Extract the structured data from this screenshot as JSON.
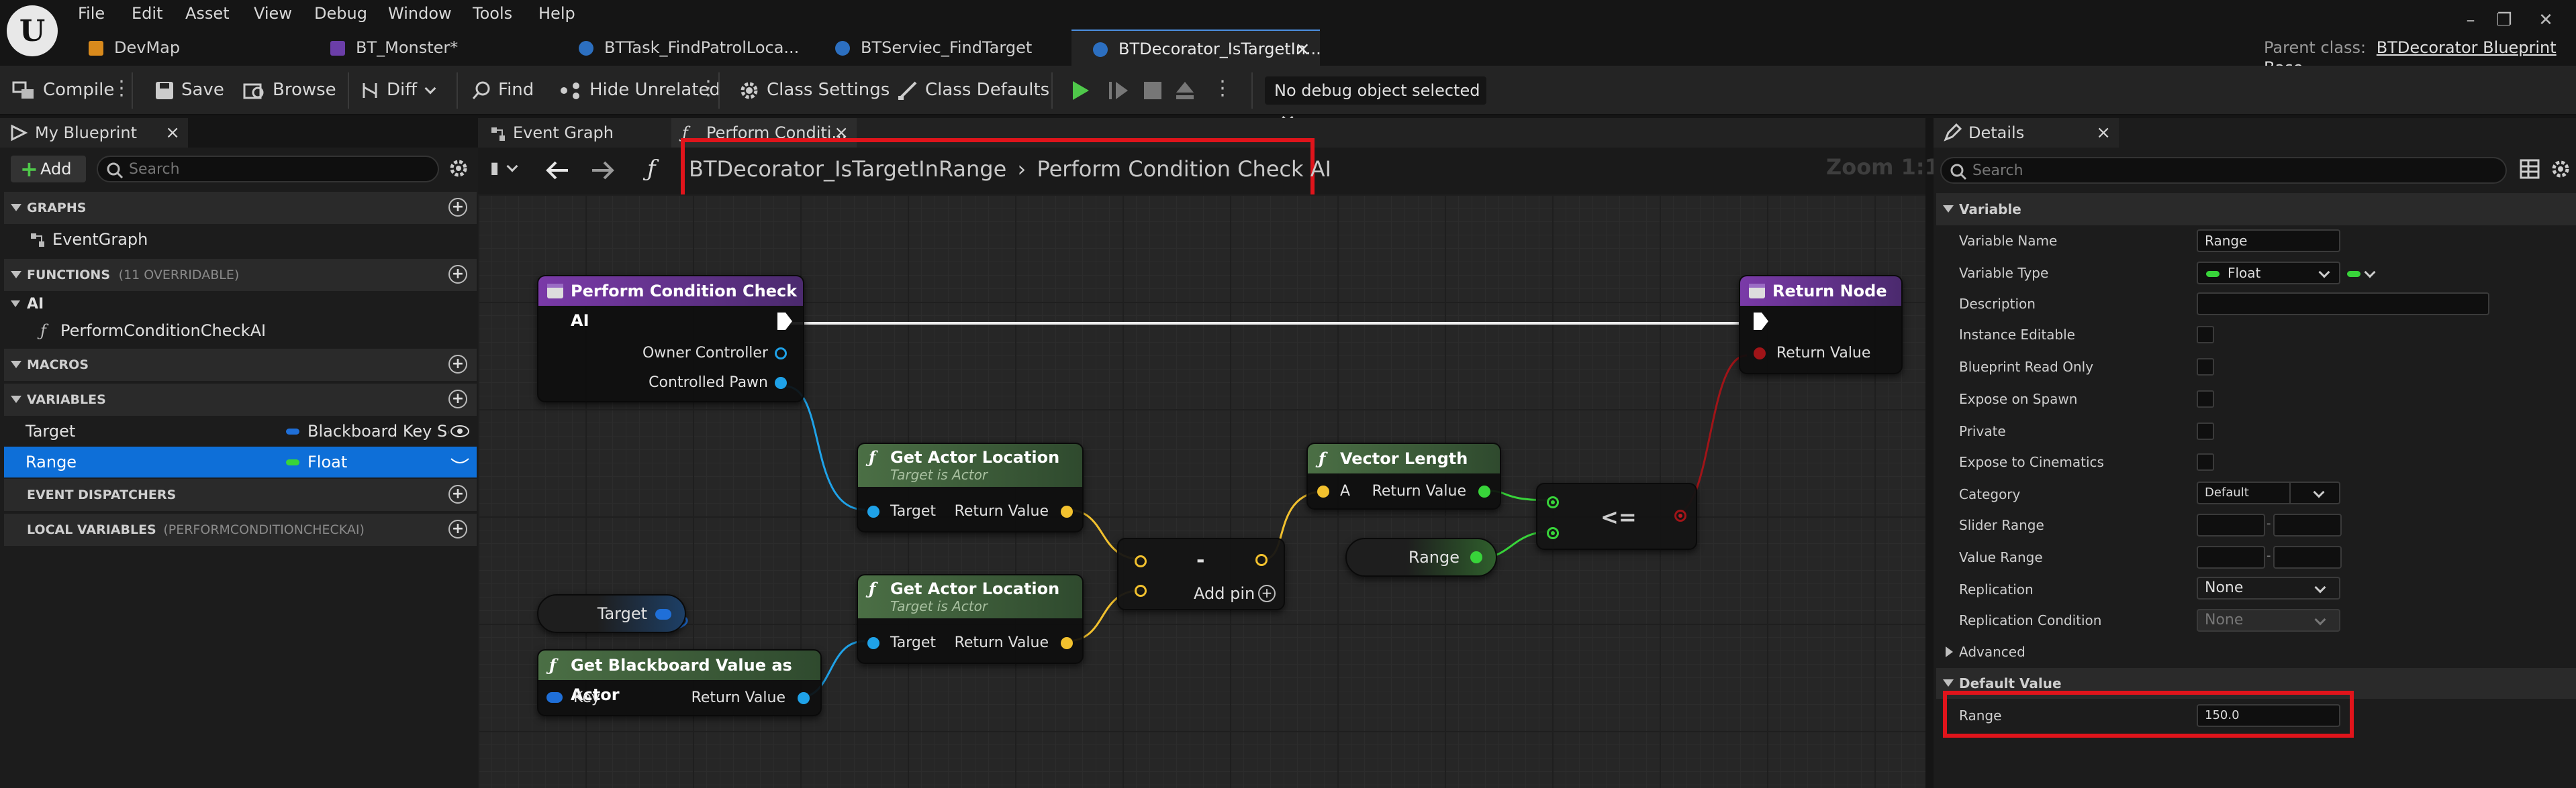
{
  "menu": [
    "File",
    "Edit",
    "Asset",
    "View",
    "Debug",
    "Window",
    "Tools",
    "Help"
  ],
  "tabs": [
    {
      "label": "DevMap",
      "icon": "map-icon"
    },
    {
      "label": "BT_Monster*",
      "icon": "behavior-tree-icon"
    },
    {
      "label": "BTTask_FindPatrolLoca...",
      "icon": "blueprint-icon"
    },
    {
      "label": "BTServiec_FindTarget",
      "icon": "blueprint-icon"
    },
    {
      "label": "BTDecorator_IsTargetIn...",
      "icon": "blueprint-icon",
      "active": true,
      "close": "×"
    }
  ],
  "parent_class": {
    "label": "Parent class:",
    "value": "BTDecorator Blueprint Base"
  },
  "toolbar": {
    "compile": "Compile",
    "save": "Save",
    "browse": "Browse",
    "diff": "Diff",
    "find": "Find",
    "hide_unrelated": "Hide Unrelated",
    "class_settings": "Class Settings",
    "class_defaults": "Class Defaults",
    "debug_object": "No debug object selected"
  },
  "my_blueprint": {
    "tab_label": "My Blueprint",
    "close": "×",
    "add_label": "Add",
    "search_placeholder": "Search",
    "sections": {
      "graphs": "GRAPHS",
      "functions": "FUNCTIONS",
      "functions_note": "(11 OVERRIDABLE)",
      "macros": "MACROS",
      "variables": "VARIABLES",
      "event_dispatchers": "EVENT DISPATCHERS",
      "local_variables": "LOCAL VARIABLES",
      "local_variables_note": "(PERFORMCONDITIONCHECKAI)"
    },
    "graph_items": [
      "EventGraph"
    ],
    "function_category": "AI",
    "function_items": [
      "PerformConditionCheckAI"
    ],
    "variables": [
      {
        "name": "Target",
        "type": "Blackboard Key Sele",
        "color": "#1f6fd8"
      },
      {
        "name": "Range",
        "type": "Float",
        "color": "#38d43a",
        "selected": true
      }
    ]
  },
  "graph": {
    "tabs": [
      "Event Graph",
      "Perform Conditi..."
    ],
    "breadcrumb_class": "BTDecorator_IsTargetInRange",
    "breadcrumb_sep": "›",
    "breadcrumb_function": "Perform Condition Check AI",
    "zoom": "Zoom 1:1",
    "nodes": {
      "entry": {
        "title": "Perform Condition Check AI",
        "pins": [
          "Owner Controller",
          "Controlled Pawn"
        ]
      },
      "return": {
        "title": "Return Node",
        "pins": [
          "Return Value"
        ]
      },
      "get_loc_1": {
        "title": "Get Actor Location",
        "subtitle": "Target is Actor",
        "in": "Target",
        "out": "Return Value"
      },
      "get_loc_2": {
        "title": "Get Actor Location",
        "subtitle": "Target is Actor",
        "in": "Target",
        "out": "Return Value"
      },
      "subtract": {
        "op": "-",
        "add_pin": "Add pin"
      },
      "vector_length": {
        "title": "Vector Length",
        "in": "A",
        "out": "Return Value"
      },
      "range_var": {
        "label": "Range"
      },
      "compare": {
        "op": "<="
      },
      "target_var": {
        "label": "Target"
      },
      "get_bb": {
        "title": "Get Blackboard Value as Actor",
        "in": "Key",
        "out": "Return Value"
      }
    }
  },
  "details": {
    "tab_label": "Details",
    "close": "×",
    "search_placeholder": "Search",
    "variable_section": "Variable",
    "rows": {
      "variable_name": {
        "label": "Variable Name",
        "value": "Range"
      },
      "variable_type": {
        "label": "Variable Type",
        "value": "Float"
      },
      "description": {
        "label": "Description",
        "value": ""
      },
      "instance_editable": {
        "label": "Instance Editable",
        "checked": false
      },
      "blueprint_read_only": {
        "label": "Blueprint Read Only",
        "checked": false
      },
      "expose_on_spawn": {
        "label": "Expose on Spawn",
        "checked": false
      },
      "private": {
        "label": "Private",
        "checked": false
      },
      "expose_to_cinematics": {
        "label": "Expose to Cinematics",
        "checked": false
      },
      "category": {
        "label": "Category",
        "value": "Default"
      },
      "slider_range": {
        "label": "Slider Range",
        "separator": "-"
      },
      "value_range": {
        "label": "Value Range",
        "separator": "-"
      },
      "replication": {
        "label": "Replication",
        "value": "None"
      },
      "replication_condition": {
        "label": "Replication Condition",
        "value": "None"
      }
    },
    "advanced": "Advanced",
    "default_value_section": "Default Value",
    "default_range": {
      "label": "Range",
      "value": "150.0"
    }
  },
  "colors": {
    "accent": "#0e6fd8",
    "float_pin": "#38d43a",
    "vector_pin": "#f2c12e",
    "object_pin": "#1fa2e8",
    "highlight": "#e0141b",
    "function_header": "#7a3aa8"
  }
}
